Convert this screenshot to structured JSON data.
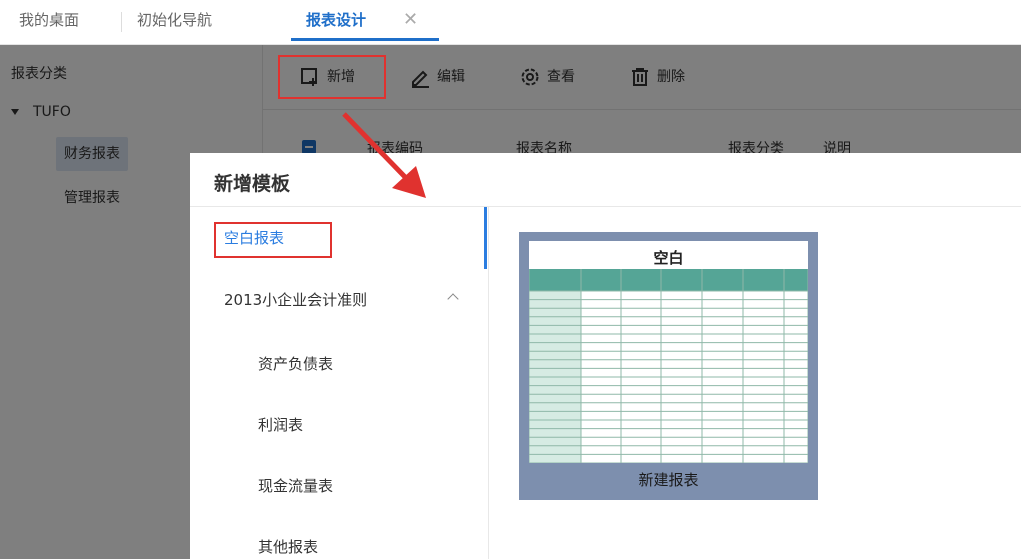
{
  "tabs": {
    "items": [
      {
        "label": "我的桌面"
      },
      {
        "label": "初始化导航"
      },
      {
        "label": "报表设计"
      }
    ],
    "close_symbol": "✕"
  },
  "tree": {
    "title": "报表分类",
    "root": "TUFO",
    "nodes": [
      "财务报表",
      "管理报表"
    ]
  },
  "toolbar": {
    "add_label": "新增",
    "edit_label": "编辑",
    "view_label": "查看",
    "delete_label": "删除",
    "icons": [
      "add-icon",
      "edit-pen-icon",
      "gear-icon",
      "trash-icon"
    ]
  },
  "grid": {
    "columns": [
      "报表编码",
      "报表名称",
      "报表分类",
      "说明"
    ]
  },
  "modal": {
    "title": "新增模板",
    "side": {
      "blank": "空白报表",
      "group": "2013小企业会计准则",
      "children": [
        "资产负债表",
        "利润表",
        "现金流量表",
        "其他报表"
      ]
    },
    "card": {
      "title": "空白",
      "label": "新建报表",
      "header_color": "#55a596",
      "first_col_color": "#d6ebe3",
      "border_color": "#7d8fae"
    }
  },
  "colors": {
    "accent": "#1f6fc9",
    "highlight_red": "#e0322f"
  }
}
